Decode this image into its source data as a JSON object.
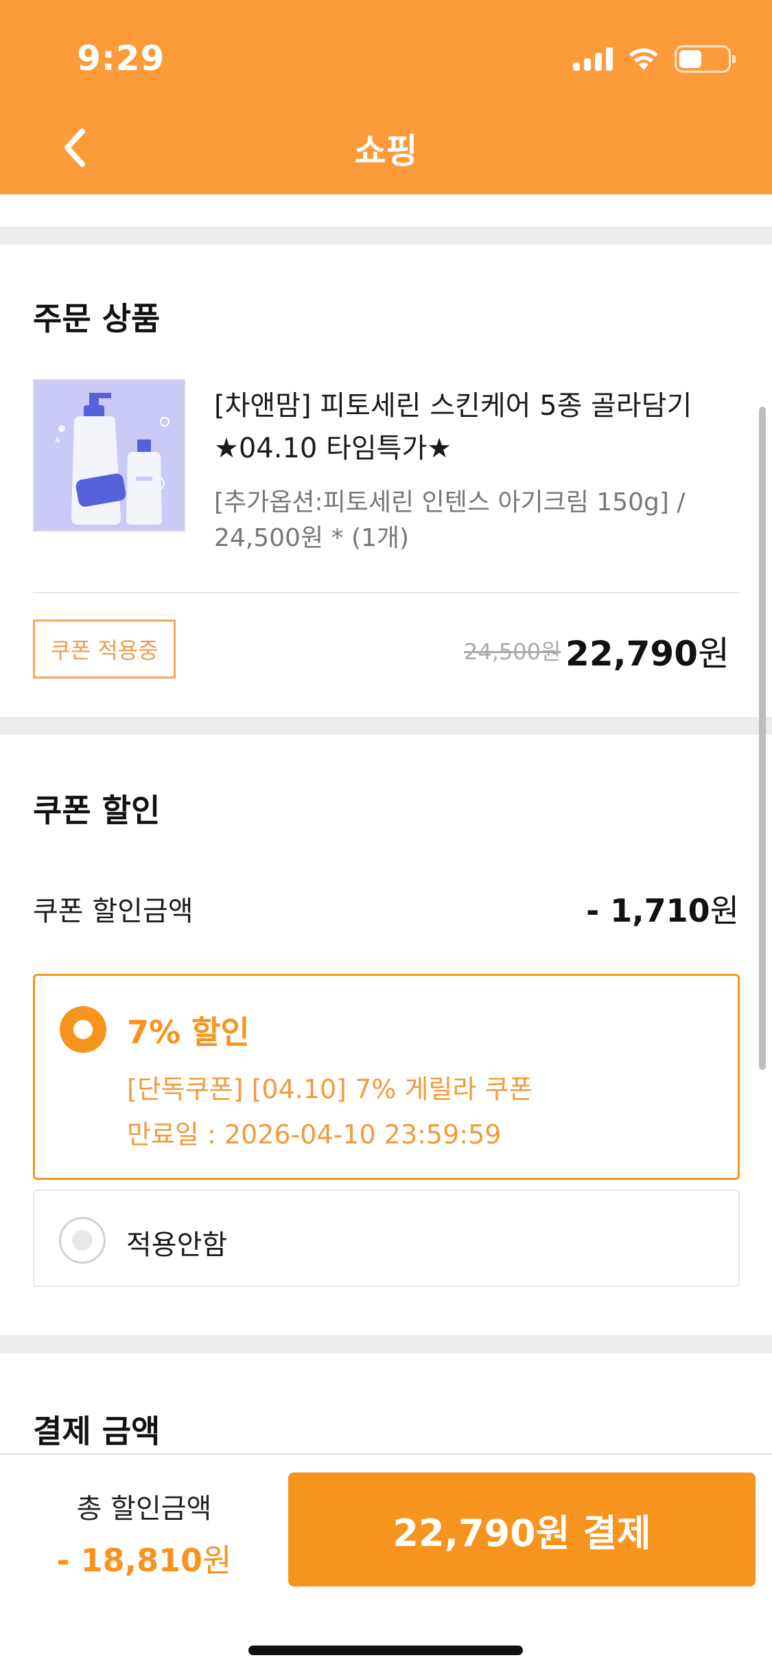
{
  "status_bar": {
    "time": "9:29",
    "battery_level": 0.45
  },
  "nav": {
    "title": "쇼핑",
    "back_icon": "chevron-left-icon"
  },
  "order": {
    "section_title": "주문 상품",
    "product": {
      "name_line1": "[차앤맘] 피토세린 스킨케어 5종 골라담기",
      "name_line2": "★04.10 타임특가★",
      "option_line1": "[추가옵션:피토세린 인텐스 아기크림 150g] /",
      "option_line2": "24,500원 * (1개)"
    },
    "coupon_badge": "쿠폰 적용중",
    "original_price": "24,500원",
    "final_price_number": "22,790",
    "final_price_unit": "원"
  },
  "coupon": {
    "section_title": "쿠폰 할인",
    "discount_label": "쿠폰 할인금액",
    "discount_value_number": "- 1,710",
    "discount_value_unit": "원",
    "options": [
      {
        "title": "7% 할인",
        "name": "[단독쿠폰] [04.10] 7% 게릴라 쿠폰",
        "expiry": "만료일 : 2026-04-10 23:59:59",
        "selected": true
      },
      {
        "title": "적용안함",
        "selected": false
      }
    ]
  },
  "payment": {
    "section_title": "결제 금액"
  },
  "bottom_bar": {
    "total_discount_label": "총 할인금액",
    "total_discount_number": "- 18,810",
    "total_discount_unit": "원",
    "pay_button_label": "22,790원 결제"
  },
  "colors": {
    "header": "#fd9a3a",
    "accent": "#f7941d"
  }
}
